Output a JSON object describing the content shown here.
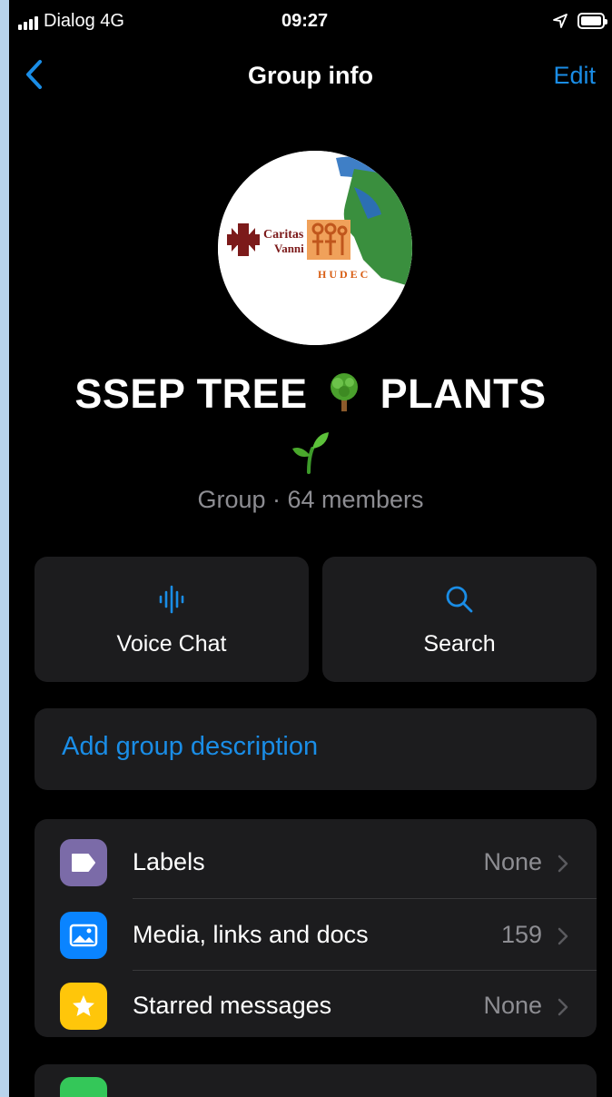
{
  "status": {
    "carrier": "Dialog  4G",
    "time": "09:27"
  },
  "nav": {
    "title": "Group info",
    "edit_label": "Edit"
  },
  "avatar": {
    "logo_text_1": "Caritas",
    "logo_text_2": "Vanni",
    "logo_text_3": "H U D E C"
  },
  "group": {
    "name_part1": "SSEP TREE",
    "name_part2": "PLANTS",
    "subtitle": "Group · 64 members"
  },
  "actions": [
    {
      "label": "Voice Chat",
      "icon": "voice-wave-icon"
    },
    {
      "label": "Search",
      "icon": "search-icon"
    }
  ],
  "description": {
    "placeholder": "Add group description"
  },
  "list": [
    {
      "label": "Labels",
      "value": "None",
      "icon": "label-tag-icon",
      "color": "#7b6ba8"
    },
    {
      "label": "Media, links and docs",
      "value": "159",
      "icon": "photo-icon",
      "color": "#0a84ff"
    },
    {
      "label": "Starred messages",
      "value": "None",
      "icon": "star-icon",
      "color": "#ffc60a"
    }
  ],
  "colors": {
    "accent": "#1a8de6",
    "background": "#000000",
    "card": "#1c1c1e",
    "secondary_text": "#8d8d92"
  }
}
